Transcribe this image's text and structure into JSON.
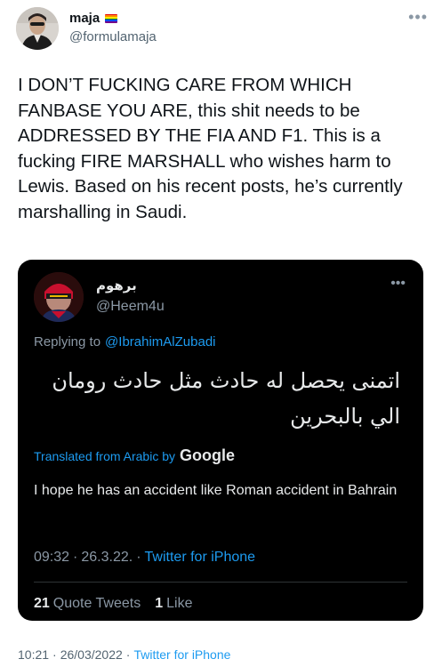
{
  "author": {
    "name": "maja",
    "handle": "@formulamaja",
    "flag_colors": [
      "#e40303",
      "#ff8c00",
      "#ffed00",
      "#008026",
      "#004dff",
      "#750787"
    ]
  },
  "tweet": {
    "text": "I DON’T FUCKING CARE FROM WHICH FANBASE YOU ARE, this shit needs to be ADDRESSED BY THE FIA AND F1. This is a fucking FIRE MARSHALL who wishes harm to Lewis. Based on his recent posts, he’s currently marshalling in Saudi.",
    "time": "10:21",
    "date": "26/03/2022",
    "source": "Twitter for iPhone"
  },
  "quote": {
    "name": "برهوم",
    "handle": "@Heem4u",
    "replying_label": "Replying to",
    "replying_to": "@IbrahimAlZubadi",
    "arabic_text": "اتمنى يحصل له حادث مثل حادث رومان الي بالبحرين",
    "translated_label": "Translated from Arabic by",
    "translator": "Google",
    "translation": "I hope he has an accident like Roman accident in Bahrain",
    "time": "09:32",
    "date": "26.3.22.",
    "source": "Twitter for iPhone",
    "quote_tweets_count": "21",
    "quote_tweets_label": "Quote Tweets",
    "likes_count": "1",
    "likes_label": "Like"
  },
  "separator": "·",
  "icons": {
    "more": "more-dots-icon"
  }
}
